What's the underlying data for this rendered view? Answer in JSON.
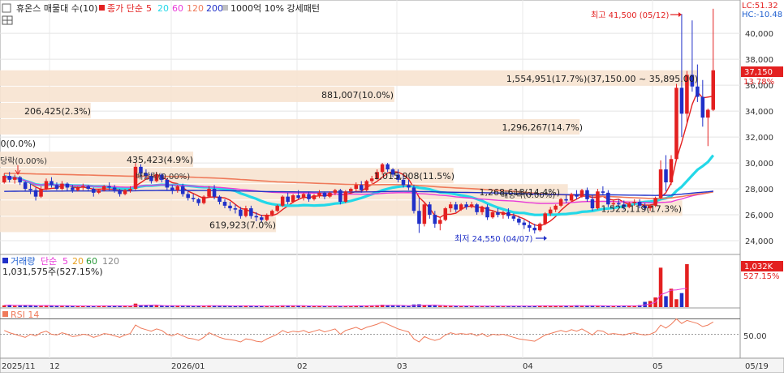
{
  "header": {
    "stock_title": "휴온스 매물대 수(10)",
    "ma_label": "종가 단순",
    "ma_periods": [
      {
        "label": "5",
        "color": "#e32020"
      },
      {
        "label": "20",
        "color": "#23d8e8"
      },
      {
        "label": "60",
        "color": "#e83ad8"
      },
      {
        "label": "120",
        "color": "#ef7a5a"
      },
      {
        "label": "200",
        "color": "#2030c8"
      }
    ],
    "pattern_label": "1000억 10% 강세패턴",
    "lc_label": "LC:51.32",
    "hc_label": "HC:-10.48"
  },
  "price_panel": {
    "y_ticks": [
      "40,000",
      "38,000",
      "36,000",
      "34,000",
      "32,000",
      "30,000",
      "28,000",
      "26,000",
      "24,000"
    ],
    "current_price": "37,150",
    "current_change": "13.78%",
    "high_annotation": "최고 41,500 (05/12)",
    "low_annotation": "최저 24,550 (04/07)",
    "volume_profile_labels": [
      "1,554,951(17.7%)(37,150.00 ~ 35,895.00)",
      "881,007(10.0%)",
      "206,425(2.3%)",
      "1,296,267(14.7%)",
      "0(0.0%)",
      "435,423(4.9%)",
      "1,015,908(11.5%)",
      "1,268,618(14.4%)",
      "1,525,119(17.3%)",
      "619,923(7.0%)"
    ],
    "event_labels": [
      "당락(0.00%)",
      "배당락(0.00%)",
      "배당락(0.00%)"
    ]
  },
  "volume_panel": {
    "label": "거래량",
    "ma_label": "단순",
    "ma_periods": [
      {
        "label": "5",
        "color": "#e83ad8"
      },
      {
        "label": "20",
        "color": "#e8a020"
      },
      {
        "label": "60",
        "color": "#2a9a3a"
      },
      {
        "label": "120",
        "color": "#888888"
      }
    ],
    "last_volume": "1,031,575주(527.15%)",
    "right_value": "1,032K",
    "right_pct": "527.15%"
  },
  "rsi_panel": {
    "label": "RSI 14",
    "tick": "50.00"
  },
  "x_axis": {
    "labels": [
      "2025/11",
      "12",
      "2026/01",
      "02",
      "03",
      "04",
      "05",
      "05/19"
    ]
  },
  "chart_data": {
    "type": "candlestick",
    "x_start": "2025-11-01",
    "x_end": "2026-05-19",
    "ylim": [
      23000,
      42200
    ],
    "grid": true,
    "price_series": [
      [
        28500,
        29200,
        28400,
        29000
      ],
      [
        29000,
        29300,
        28500,
        28700
      ],
      [
        28700,
        29100,
        28400,
        28900
      ],
      [
        28900,
        29000,
        28300,
        28500
      ],
      [
        28500,
        28600,
        27800,
        28000
      ],
      [
        28000,
        28400,
        27600,
        27900
      ],
      [
        27900,
        28100,
        27100,
        27400
      ],
      [
        27400,
        28200,
        27300,
        28000
      ],
      [
        28000,
        28800,
        27900,
        28600
      ],
      [
        28600,
        28900,
        28100,
        28300
      ],
      [
        28300,
        28500,
        27900,
        28000
      ],
      [
        28000,
        28600,
        27900,
        28400
      ],
      [
        28400,
        28500,
        27800,
        28100
      ],
      [
        28100,
        28300,
        27700,
        27900
      ],
      [
        27900,
        28200,
        27800,
        28100
      ],
      [
        28100,
        28400,
        27900,
        28200
      ],
      [
        28200,
        28300,
        27800,
        28000
      ],
      [
        28000,
        28100,
        27400,
        27700
      ],
      [
        27700,
        28000,
        27600,
        27900
      ],
      [
        27900,
        28300,
        27800,
        28200
      ],
      [
        28200,
        28500,
        27900,
        28100
      ],
      [
        28100,
        28300,
        27700,
        27900
      ],
      [
        27900,
        28000,
        27400,
        27600
      ],
      [
        27600,
        28000,
        27500,
        27900
      ],
      [
        27900,
        28200,
        27700,
        28000
      ],
      [
        28000,
        30000,
        27900,
        29700
      ],
      [
        29700,
        29900,
        28900,
        29200
      ],
      [
        29200,
        29500,
        28800,
        29000
      ],
      [
        29000,
        29200,
        28400,
        28600
      ],
      [
        28600,
        29300,
        28500,
        29100
      ],
      [
        29100,
        29200,
        28500,
        28700
      ],
      [
        28700,
        28800,
        27900,
        28100
      ],
      [
        28100,
        28300,
        27600,
        27900
      ],
      [
        27900,
        28300,
        27700,
        28200
      ],
      [
        28200,
        28400,
        27400,
        27600
      ],
      [
        27600,
        27800,
        27100,
        27300
      ],
      [
        27300,
        27600,
        27000,
        27200
      ],
      [
        27200,
        27300,
        26700,
        26900
      ],
      [
        26900,
        27500,
        26800,
        27400
      ],
      [
        27400,
        28200,
        27300,
        28000
      ],
      [
        28000,
        28300,
        27200,
        27400
      ],
      [
        27400,
        27500,
        26800,
        27000
      ],
      [
        27000,
        27200,
        26500,
        26700
      ],
      [
        26700,
        27000,
        26300,
        26500
      ],
      [
        26500,
        26800,
        26100,
        26400
      ],
      [
        26400,
        26600,
        25700,
        25900
      ],
      [
        25900,
        26700,
        25800,
        26500
      ],
      [
        26500,
        26700,
        25700,
        25900
      ],
      [
        25900,
        26200,
        25500,
        25800
      ],
      [
        25800,
        26000,
        25400,
        25600
      ],
      [
        25600,
        26100,
        25500,
        26000
      ],
      [
        26000,
        26400,
        25900,
        26300
      ],
      [
        26300,
        26800,
        26200,
        26700
      ],
      [
        26700,
        27500,
        26600,
        27400
      ],
      [
        27400,
        27700,
        26800,
        27000
      ],
      [
        27000,
        27600,
        26900,
        27500
      ],
      [
        27500,
        27900,
        27200,
        27300
      ],
      [
        27300,
        27700,
        27100,
        27600
      ],
      [
        27600,
        27800,
        27000,
        27200
      ],
      [
        27200,
        27600,
        27100,
        27500
      ],
      [
        27500,
        27900,
        27300,
        27700
      ],
      [
        27700,
        27800,
        27200,
        27400
      ],
      [
        27400,
        27800,
        27300,
        27700
      ],
      [
        27700,
        28000,
        27500,
        27900
      ],
      [
        27900,
        28000,
        26800,
        27000
      ],
      [
        27000,
        27900,
        26900,
        27800
      ],
      [
        27800,
        28100,
        27600,
        28000
      ],
      [
        28000,
        28500,
        27800,
        28300
      ],
      [
        28300,
        28600,
        27700,
        27900
      ],
      [
        27900,
        28700,
        27800,
        28600
      ],
      [
        28600,
        29000,
        28400,
        28800
      ],
      [
        28800,
        29500,
        28700,
        29300
      ],
      [
        29300,
        30000,
        29100,
        29900
      ],
      [
        29900,
        30000,
        29300,
        29500
      ],
      [
        29500,
        29600,
        28900,
        29100
      ],
      [
        29100,
        29500,
        28500,
        28700
      ],
      [
        28700,
        29100,
        28100,
        28300
      ],
      [
        28300,
        28700,
        27900,
        28100
      ],
      [
        28100,
        28300,
        26100,
        26300
      ],
      [
        26300,
        27300,
        24600,
        25300
      ],
      [
        25300,
        27000,
        25100,
        26800
      ],
      [
        26800,
        27000,
        25700,
        26000
      ],
      [
        26000,
        26300,
        25000,
        25300
      ],
      [
        25300,
        25800,
        24800,
        25600
      ],
      [
        25600,
        26600,
        25500,
        26500
      ],
      [
        26500,
        27000,
        26200,
        26800
      ],
      [
        26800,
        27000,
        26200,
        26400
      ],
      [
        26400,
        26900,
        26300,
        26800
      ],
      [
        26800,
        27000,
        26400,
        26600
      ],
      [
        26600,
        27000,
        26500,
        26800
      ],
      [
        26800,
        26900,
        26000,
        26200
      ],
      [
        26200,
        26700,
        26000,
        26600
      ],
      [
        26600,
        26800,
        25600,
        25800
      ],
      [
        25800,
        26300,
        25700,
        26200
      ],
      [
        26200,
        26500,
        25800,
        26000
      ],
      [
        26000,
        26300,
        25700,
        26200
      ],
      [
        26200,
        26500,
        25700,
        25900
      ],
      [
        25900,
        26100,
        25500,
        25700
      ],
      [
        25700,
        25900,
        25200,
        25400
      ],
      [
        25400,
        25600,
        24900,
        25200
      ],
      [
        25200,
        25500,
        24700,
        25000
      ],
      [
        25000,
        25300,
        24550,
        24800
      ],
      [
        24800,
        25400,
        24700,
        25300
      ],
      [
        25300,
        26200,
        25200,
        26100
      ],
      [
        26100,
        26600,
        25900,
        26400
      ],
      [
        26400,
        26800,
        26200,
        26700
      ],
      [
        26700,
        27300,
        26600,
        27200
      ],
      [
        27200,
        27600,
        26900,
        27100
      ],
      [
        27100,
        27700,
        27000,
        27600
      ],
      [
        27600,
        27900,
        27200,
        27400
      ],
      [
        27400,
        28000,
        27300,
        27900
      ],
      [
        27900,
        28100,
        27000,
        27200
      ],
      [
        27200,
        27500,
        26300,
        26500
      ],
      [
        26500,
        28000,
        26400,
        27800
      ],
      [
        27800,
        28200,
        27500,
        27700
      ],
      [
        27700,
        27900,
        26600,
        26800
      ],
      [
        26800,
        27100,
        26500,
        26900
      ],
      [
        26900,
        27200,
        26600,
        26800
      ],
      [
        26800,
        27100,
        26400,
        26600
      ],
      [
        26600,
        27000,
        26500,
        26900
      ],
      [
        26900,
        27200,
        26700,
        27000
      ],
      [
        27000,
        27200,
        26500,
        26700
      ],
      [
        26700,
        26900,
        26300,
        26500
      ],
      [
        26500,
        26800,
        26300,
        26700
      ],
      [
        26700,
        27400,
        26600,
        27300
      ],
      [
        27300,
        30200,
        27200,
        29500
      ],
      [
        29500,
        30600,
        27800,
        28500
      ],
      [
        28500,
        30600,
        28300,
        30300
      ],
      [
        30300,
        36100,
        30200,
        35800
      ],
      [
        35800,
        41500,
        32000,
        33800
      ],
      [
        33800,
        37100,
        33100,
        36800
      ],
      [
        36800,
        41000,
        35500,
        35900
      ],
      [
        35900,
        37600,
        34700,
        35100
      ],
      [
        35100,
        36400,
        32800,
        33500
      ],
      [
        33500,
        34200,
        31300,
        34100
      ],
      [
        34100,
        41900,
        34000,
        37150
      ]
    ],
    "volume_series": [
      40,
      55,
      30,
      35,
      42,
      38,
      28,
      32,
      45,
      30,
      28,
      35,
      30,
      25,
      22,
      30,
      28,
      26,
      30,
      35,
      25,
      28,
      30,
      26,
      32,
      80,
      45,
      40,
      38,
      35,
      30,
      28,
      33,
      30,
      35,
      28,
      25,
      30,
      32,
      38,
      30,
      28,
      26,
      30,
      25,
      35,
      30,
      28,
      25,
      22,
      25,
      30,
      35,
      40,
      32,
      30,
      28,
      26,
      25,
      30,
      28,
      22,
      25,
      30,
      28,
      26,
      30,
      35,
      28,
      30,
      38,
      45,
      55,
      40,
      35,
      30,
      28,
      25,
      60,
      65,
      45,
      38,
      35,
      30,
      32,
      28,
      26,
      25,
      28,
      30,
      24,
      22,
      25,
      28,
      30,
      26,
      24,
      22,
      28,
      30,
      25,
      30,
      35,
      32,
      28,
      26,
      30,
      35,
      28,
      40,
      32,
      30,
      28,
      25,
      30,
      28,
      26,
      30,
      35,
      32,
      28,
      45,
      120,
      140,
      220,
      900,
      250,
      420,
      180,
      320,
      980
    ],
    "rsi_series": [
      55,
      52,
      50,
      48,
      46,
      50,
      48,
      52,
      54,
      50,
      49,
      52,
      50,
      47,
      48,
      50,
      49,
      46,
      48,
      51,
      50,
      48,
      46,
      49,
      51,
      62,
      58,
      56,
      54,
      57,
      55,
      50,
      48,
      51,
      48,
      45,
      44,
      42,
      46,
      52,
      49,
      46,
      44,
      43,
      42,
      40,
      44,
      43,
      41,
      40,
      44,
      47,
      50,
      55,
      52,
      54,
      53,
      55,
      52,
      54,
      56,
      53,
      55,
      57,
      50,
      55,
      57,
      59,
      56,
      59,
      61,
      63,
      66,
      63,
      60,
      57,
      55,
      53,
      44,
      40,
      47,
      44,
      42,
      44,
      49,
      52,
      50,
      51,
      50,
      51,
      48,
      51,
      47,
      50,
      49,
      50,
      48,
      46,
      44,
      43,
      42,
      41,
      45,
      49,
      51,
      53,
      55,
      53,
      56,
      54,
      57,
      53,
      49,
      55,
      54,
      50,
      51,
      50,
      49,
      51,
      52,
      50,
      49,
      50,
      53,
      62,
      58,
      63,
      70,
      64,
      68,
      66,
      64,
      60,
      62,
      66
    ],
    "ma_series": [
      {
        "name": "5",
        "color": "#e32020"
      },
      {
        "name": "20",
        "color": "#23d8e8"
      },
      {
        "name": "60",
        "color": "#e83ad8"
      },
      {
        "name": "120",
        "color": "#ef7a5a"
      },
      {
        "name": "200",
        "color": "#2030c8"
      }
    ],
    "volume_profile": [
      {
        "label": "1,554,951(17.7%)(37,150.00 ~ 35,895.00)",
        "low": 35895,
        "high": 37150,
        "pct": 17.7
      },
      {
        "label": "881,007(10.0%)",
        "low": 34640,
        "high": 35895,
        "pct": 10.0
      },
      {
        "label": "206,425(2.3%)",
        "low": 33385,
        "high": 34640,
        "pct": 2.3
      },
      {
        "label": "1,296,267(14.7%)",
        "low": 32130,
        "high": 33385,
        "pct": 14.7
      },
      {
        "label": "0(0.0%)",
        "low": 30875,
        "high": 32130,
        "pct": 0.0
      },
      {
        "label": "435,423(4.9%)",
        "low": 29620,
        "high": 30875,
        "pct": 4.9
      },
      {
        "label": "1,015,908(11.5%)",
        "low": 28365,
        "high": 29620,
        "pct": 11.5
      },
      {
        "label": "1,268,618(14.4%)",
        "low": 27110,
        "high": 28365,
        "pct": 14.4
      },
      {
        "label": "1,525,119(17.3%)",
        "low": 25855,
        "high": 27110,
        "pct": 17.3
      },
      {
        "label": "619,923(7.0%)",
        "low": 24600,
        "high": 25855,
        "pct": 7.0
      }
    ]
  }
}
